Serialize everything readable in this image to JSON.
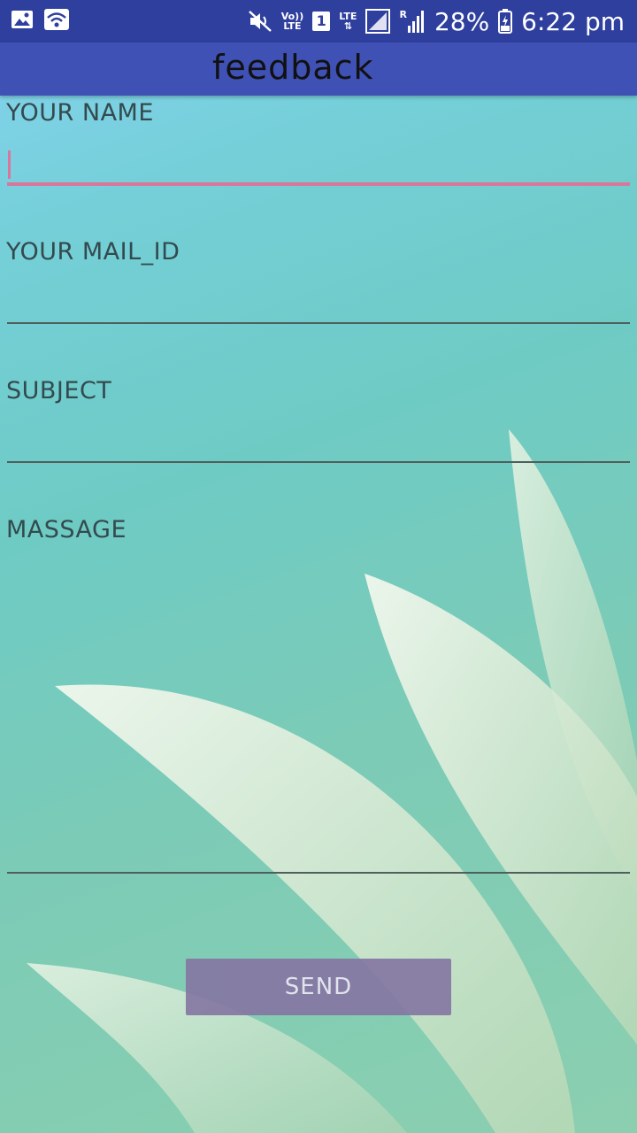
{
  "status_bar": {
    "icons": [
      "image-icon",
      "wifi-icon",
      "mute-icon",
      "volte-icon",
      "sim-icon",
      "lte-icon",
      "signal-icon",
      "signal-roaming-icon",
      "battery-icon"
    ],
    "volte_label_top": "Vo))",
    "volte_label_bottom": "LTE",
    "sim_number": "1",
    "lte_label": "LTE",
    "roaming_label": "R",
    "battery_percent": "28%",
    "time": "6:22 pm"
  },
  "app_bar": {
    "title": "feedback"
  },
  "form": {
    "name": {
      "label": "YOUR NAME",
      "value": ""
    },
    "mail": {
      "label": "YOUR MAIL_ID",
      "value": ""
    },
    "subject": {
      "label": "SUBJECT",
      "value": ""
    },
    "message": {
      "label": "MASSAGE",
      "value": ""
    },
    "send_label": "SEND"
  },
  "colors": {
    "status_bar": "#2f3f9e",
    "app_bar": "#3f51b5",
    "focused_underline": "#d9779a",
    "send_button": "#8677a3"
  }
}
